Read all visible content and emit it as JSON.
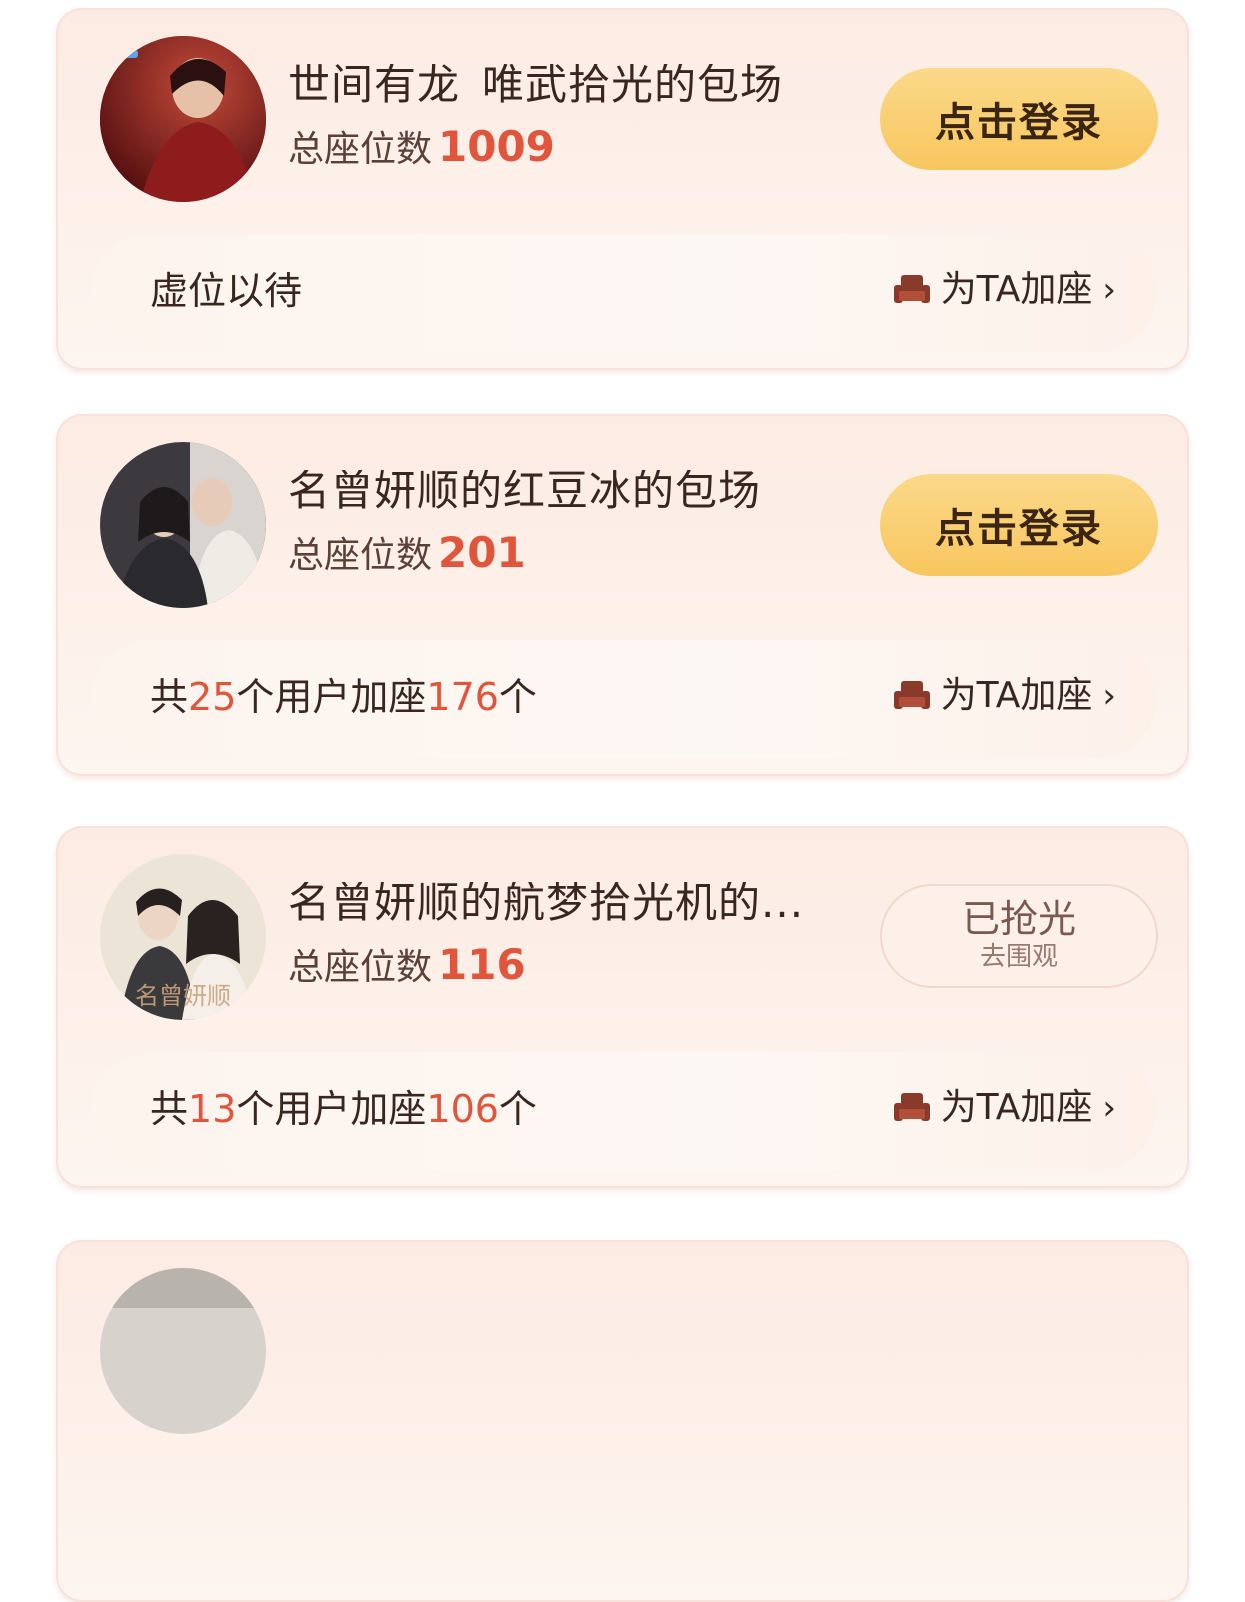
{
  "cards": [
    {
      "title": "世间有龙_唯武拾光的包场",
      "seats_label": "总座位数",
      "seats_count": "1009",
      "action": "点击登录",
      "bar_text": "虚位以待",
      "add_seat": "为TA加座"
    },
    {
      "title": "名曾妍顺的红豆冰的包场",
      "seats_label": "总座位数",
      "seats_count": "201",
      "action": "点击登录",
      "bar_prefix": "共",
      "bar_users": "25",
      "bar_mid": "个用户加座",
      "bar_added": "176",
      "bar_suffix": "个",
      "add_seat": "为TA加座"
    },
    {
      "title": "名曾妍顺的航梦拾光机的...",
      "seats_label": "总座位数",
      "seats_count": "116",
      "action_main": "已抢光",
      "action_sub": "去围观",
      "bar_prefix": "共",
      "bar_users": "13",
      "bar_mid": "个用户加座",
      "bar_added": "106",
      "bar_suffix": "个",
      "add_seat": "为TA加座",
      "avatar_caption": "名曾妍顺"
    }
  ],
  "icons": {
    "seat": "sofa-icon",
    "chevron": "chevron-right-icon"
  },
  "colors": {
    "accent": "#e0553b",
    "button": "#f8c65e",
    "card_bg": "#fcebe3"
  }
}
